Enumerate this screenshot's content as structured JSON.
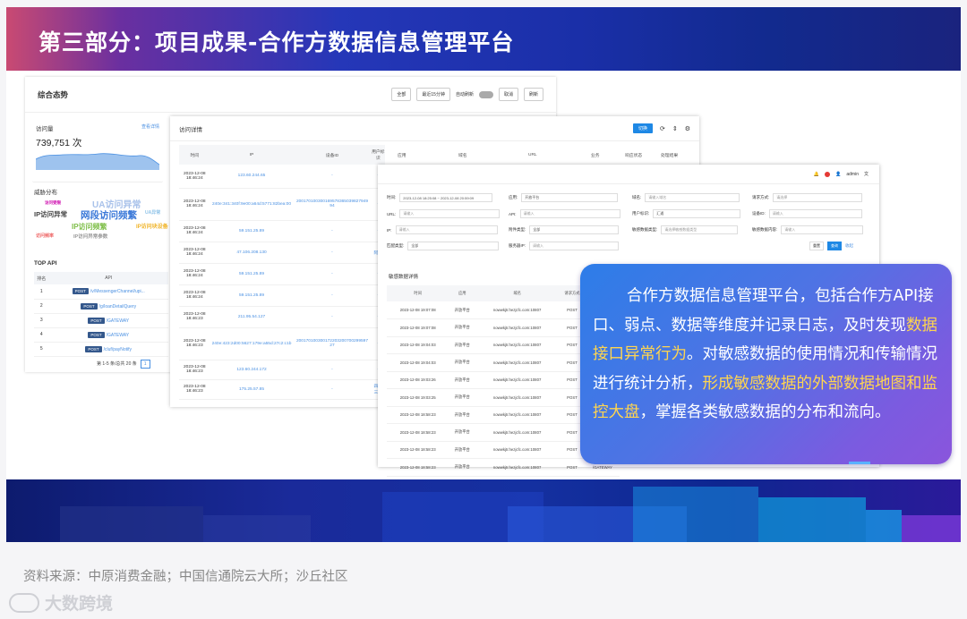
{
  "banner": {
    "title": "第三部分：项目成果-合作方数据信息管理平台"
  },
  "panel_overview": {
    "title": "综合态势",
    "filter_all": "全部",
    "filter_time": "最近15分钟",
    "auto_refresh": "自动刷新",
    "btn_apply": "取消",
    "btn_refresh": "刷新",
    "visits_label": "访问量",
    "visits_link": "查看详情",
    "visits_value": "739,751 次",
    "threat_title": "威胁分布",
    "cloud_words": [
      {
        "t": "UA访问异常",
        "c": "#a9c2ea"
      },
      {
        "t": "IP访问异常",
        "c": "#444"
      },
      {
        "t": "网段访问频繁",
        "c": "#3a78d8"
      },
      {
        "t": "IP访问频繁",
        "c": "#7fbf4a"
      },
      {
        "t": "IP访问块设备",
        "c": "#f0b429"
      },
      {
        "t": "IP访问异常参数",
        "c": "#999"
      },
      {
        "t": "访问频率",
        "c": "#e66"
      },
      {
        "t": "UA异常",
        "c": "#8fc3e8"
      },
      {
        "t": "访问受限",
        "c": "#c0a"
      }
    ],
    "top_api_title": "TOP API",
    "top_api_cols": [
      "排名",
      "API"
    ],
    "top_api_rows": [
      {
        "rank": "1",
        "method": "POST",
        "api": "/v/MessengerChannel/upi..."
      },
      {
        "rank": "2",
        "method": "POST",
        "api": "/g/loanDetailQuery"
      },
      {
        "rank": "3",
        "method": "POST",
        "api": "/GATEWAY"
      },
      {
        "rank": "4",
        "method": "POST",
        "api": "/GATEWAY"
      },
      {
        "rank": "5",
        "method": "POST",
        "api": "/cluf/payNotify"
      }
    ],
    "pager": "第 1-5 条/总共 20 条",
    "page": "1"
  },
  "panel_visits": {
    "title": "访问详情",
    "btn": "切换",
    "cols": [
      "时间",
      "IP",
      "设备ID",
      "用户标识",
      "应用",
      "域名",
      "URL",
      "业务",
      "响应状态",
      "处理结果"
    ],
    "rows": [
      {
        "time": "2023-12-08 18:46:24",
        "ip": "123.60.244.65",
        "dev": "-",
        "uid": "-"
      },
      {
        "time": "2023-12-08 18:46:24",
        "ip": "240e:341:340f:9e00:a64d:5771:82bea:00",
        "dev": "200170100300169578365039827949 94",
        "uid": "-"
      },
      {
        "time": "2023-12-08 18:46:24",
        "ip": "59.151.25.89",
        "dev": "-",
        "uid": "-"
      },
      {
        "time": "2023-12-08 18:46:24",
        "ip": "47.106.208.130",
        "dev": "-",
        "uid": "阿贝"
      },
      {
        "time": "2023-12-08 18:46:24",
        "ip": "59.151.25.89",
        "dev": "-",
        "uid": "-"
      },
      {
        "time": "2023-12-08 18:46:24",
        "ip": "59.151.25.89",
        "dev": "-",
        "uid": "-"
      },
      {
        "time": "2023-12-08 18:46:23",
        "ip": "211.95.54.127",
        "dev": "-",
        "uid": "-"
      },
      {
        "time": "2023-12-08 18:46:23",
        "ip": "240e:423:2d00:5627:179e:a55d:27c2:c1b",
        "dev": "200170100300172203200700299597 27",
        "uid": "-"
      },
      {
        "time": "2023-12-08 18:46:23",
        "ip": "123.60.244.172",
        "dev": "-",
        "uid": "-"
      },
      {
        "time": "2023-12-08 18:46:23",
        "ip": "175.25.57.85",
        "dev": "-",
        "uid": "四融三期"
      }
    ]
  },
  "panel_sensitive": {
    "user": "admin",
    "form": {
      "time_label": "时间:",
      "time_val": "2023-12-08 18:25:08  ~  2023-12-08 20:59:09",
      "app_label": "应用:",
      "app_val": "开放平台",
      "domain_label": "域名:",
      "domain_ph": "请输入域名",
      "method_label": "请求方式:",
      "method_ph": "请选择",
      "url_label": "URL:",
      "url_ph": "请输入",
      "api_label": "API:",
      "api_ph": "请输入",
      "user_label": "用户标识:",
      "user_val": "汇通",
      "dev_label": "设备ID:",
      "dev_ph": "请输入",
      "ip_label": "IP:",
      "ip_ph": "请输入",
      "rtype_label": "附件类型:",
      "rtype_val": "全部",
      "stype_label": "敏感数据类型:",
      "stype_ph": "请选择敏感数据类型",
      "scont_label": "敏感数据内容:",
      "scont_ph": "请输入",
      "cat_label": "匹配类型:",
      "cat_val": "全部",
      "svc_label": "服务器IP:",
      "svc_ph": "请输入",
      "reset": "重置",
      "query": "查询",
      "collapse": "收起"
    },
    "sub_title": "敏感数据详情",
    "cols": [
      "时间",
      "应用",
      "域名",
      "请求方式",
      "URL"
    ],
    "rows": [
      {
        "time": "2023-12-08 19:07:08",
        "app": "开放平台",
        "dom": "nowwkjtr.hezjcfc.com:10807",
        "m": "POST",
        "url": "/GATEWAY"
      },
      {
        "time": "2023-12-08 19:07:08",
        "app": "开放平台",
        "dom": "nowwkjtr.hezjcfc.com:10807",
        "m": "POST",
        "url": "/GATEWAY"
      },
      {
        "time": "2023-12-08 19:04:03",
        "app": "开放平台",
        "dom": "nowwkjtr.hezjcfc.com:10807",
        "m": "POST",
        "url": "/GATEWAY"
      },
      {
        "time": "2023-12-08 19:04:03",
        "app": "开放平台",
        "dom": "nowwkjtr.hezjcfc.com:10807",
        "m": "POST",
        "url": "/GATEWAY"
      },
      {
        "time": "2023-12-08 19:03:26",
        "app": "开放平台",
        "dom": "nowwkjtr.hezjcfc.com:10807",
        "m": "POST",
        "url": "/GATEWAY"
      },
      {
        "time": "2023-12-08 19:03:25",
        "app": "开放平台",
        "dom": "nowwkjtr.hezjcfc.com:10807",
        "m": "POST",
        "url": "/GATEWAY"
      },
      {
        "time": "2023-12-08 18:58:23",
        "app": "开放平台",
        "dom": "nowwkjtr.hezjcfc.com:10807",
        "m": "POST",
        "url": "/GATEWAY"
      },
      {
        "time": "2023-12-08 18:58:23",
        "app": "开放平台",
        "dom": "nowwkjtr.hezjcfc.com:10807",
        "m": "POST",
        "url": "/GATEWAY"
      },
      {
        "time": "2023-12-08 18:58:23",
        "app": "开放平台",
        "dom": "nowwkjtr.hezjcfc.com:10807",
        "m": "POST",
        "url": "/GATEWAY"
      },
      {
        "time": "2023-12-08 18:58:23",
        "app": "开放平台",
        "dom": "nowwkjtr.hezjcfc.com:10807",
        "m": "POST",
        "url": "/GATEWAY"
      }
    ]
  },
  "callout": {
    "p1": "合作方数据信息管理平台，包括合作方API接口、弱点、数据",
    "p2": "等维度并记录日志，及时发现",
    "p3": "数据接口异常行为",
    "p4": "。对敏感数据的使用情况和传输情况进行统计分析，",
    "p5": "形成敏感数据的外部数据地图和监控大盘",
    "p6": "，掌握各类敏感数据的分布和流向。"
  },
  "footer": {
    "source": "资料来源：中原消费金融；中国信通院云大所；沙丘社区",
    "watermark": "大数跨境"
  }
}
